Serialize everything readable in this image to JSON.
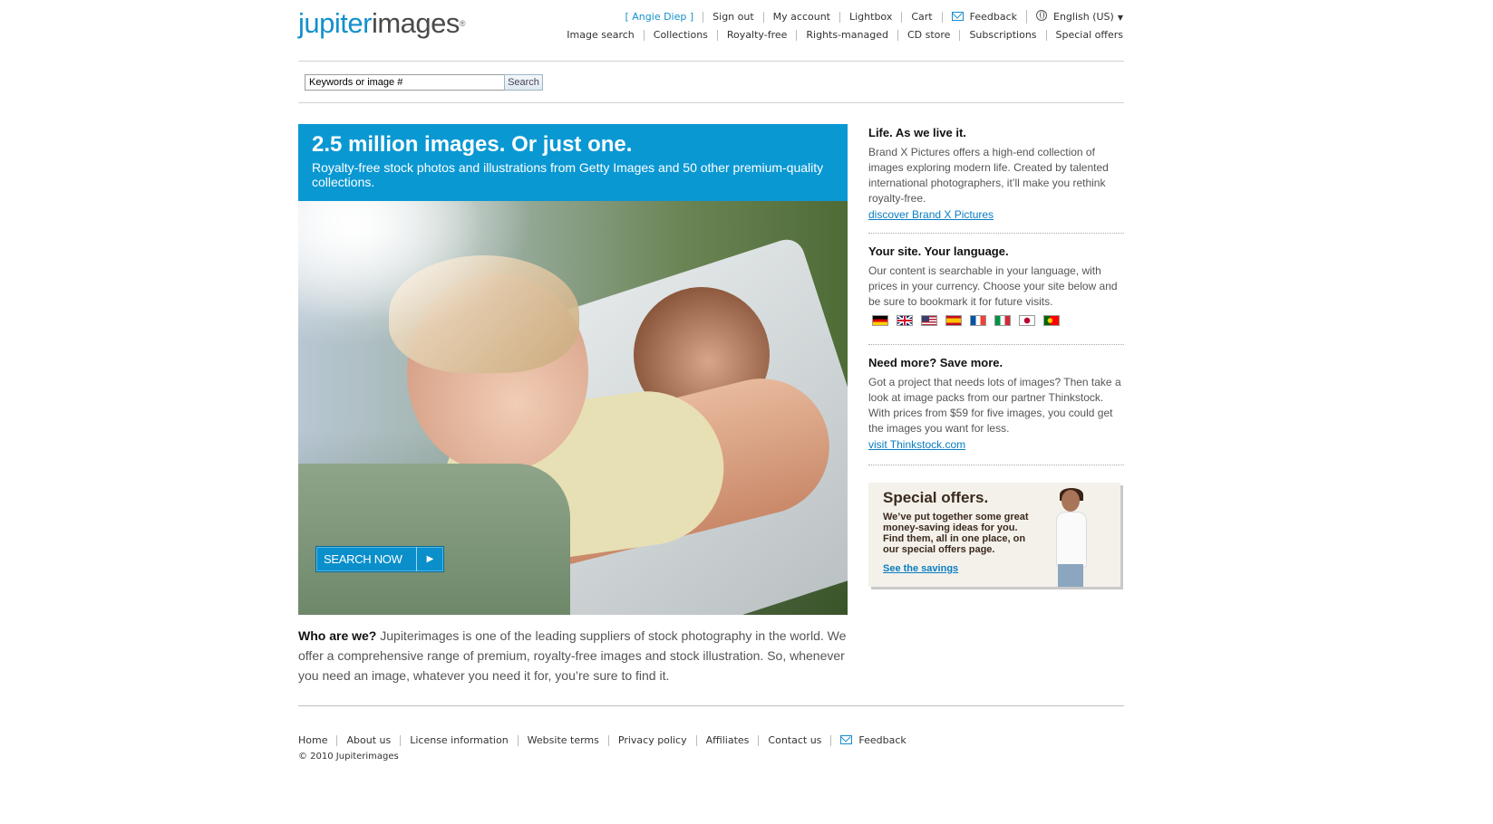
{
  "header": {
    "logo": {
      "part1": "jupiter",
      "part2": "images",
      "mark": "®"
    },
    "top_nav": {
      "user_name": "Angie Diep",
      "bracket_open": "[",
      "bracket_close": "]",
      "sign_out": "Sign out",
      "my_account": "My account",
      "lightbox": "Lightbox",
      "cart": "Cart",
      "feedback": "Feedback",
      "language": "English (US)"
    },
    "main_nav": [
      "Image search",
      "Collections",
      "Royalty-free",
      "Rights-managed",
      "CD store",
      "Subscriptions",
      "Special offers"
    ]
  },
  "search": {
    "value": "Keywords or image #",
    "button": "Search"
  },
  "hero": {
    "title": "2.5 million images. Or just one.",
    "subtitle": "Royalty-free stock photos and illustrations from Getty Images and 50 other premium-quality collections.",
    "cta": "SEARCH NOW",
    "cta_arrow": "▶"
  },
  "who": {
    "lead": "Who are we?",
    "text": " Jupiterimages is one of the leading suppliers of stock photography in the world. We offer a comprehensive range of premium, royalty-free images and stock illustration. So, whenever you need an image, whatever you need it for, you’re sure to find it."
  },
  "sidebar": {
    "brandx": {
      "title": "Life. As we live it.",
      "text": "Brand X Pictures offers a high-end collection of images exploring modern life. Created by talented international photographers, it’ll make you rethink royalty-free.",
      "link": "discover Brand X Pictures"
    },
    "language": {
      "title": "Your site. Your language.",
      "text": "Our content is searchable in your language, with prices in your currency. Choose your site below and be sure to bookmark it for future visits.",
      "flags": [
        "germany-flag",
        "uk-flag",
        "us-flag",
        "spain-flag",
        "france-flag",
        "italy-flag",
        "japan-flag",
        "portugal-flag"
      ]
    },
    "more": {
      "title": "Need more? Save more.",
      "text": "Got a project that needs lots of images? Then take a look at image packs from our partner Thinkstock. With prices from $59 for five images, you could get the images you want for less.",
      "link": "visit Thinkstock.com"
    },
    "offers": {
      "title": "Special offers.",
      "text": "We’ve put together some great money-saving ideas for you. Find them, all in one place, on our special offers page.",
      "link": "See the savings"
    }
  },
  "footer": {
    "links": [
      "Home",
      "About us",
      "License information",
      "Website terms",
      "Privacy policy",
      "Affiliates",
      "Contact us",
      "Feedback"
    ],
    "copyright": "© 2010 Jupiterimages"
  },
  "colors": {
    "brand_blue": "#0a98d3",
    "link_blue": "#0a7dc2"
  }
}
